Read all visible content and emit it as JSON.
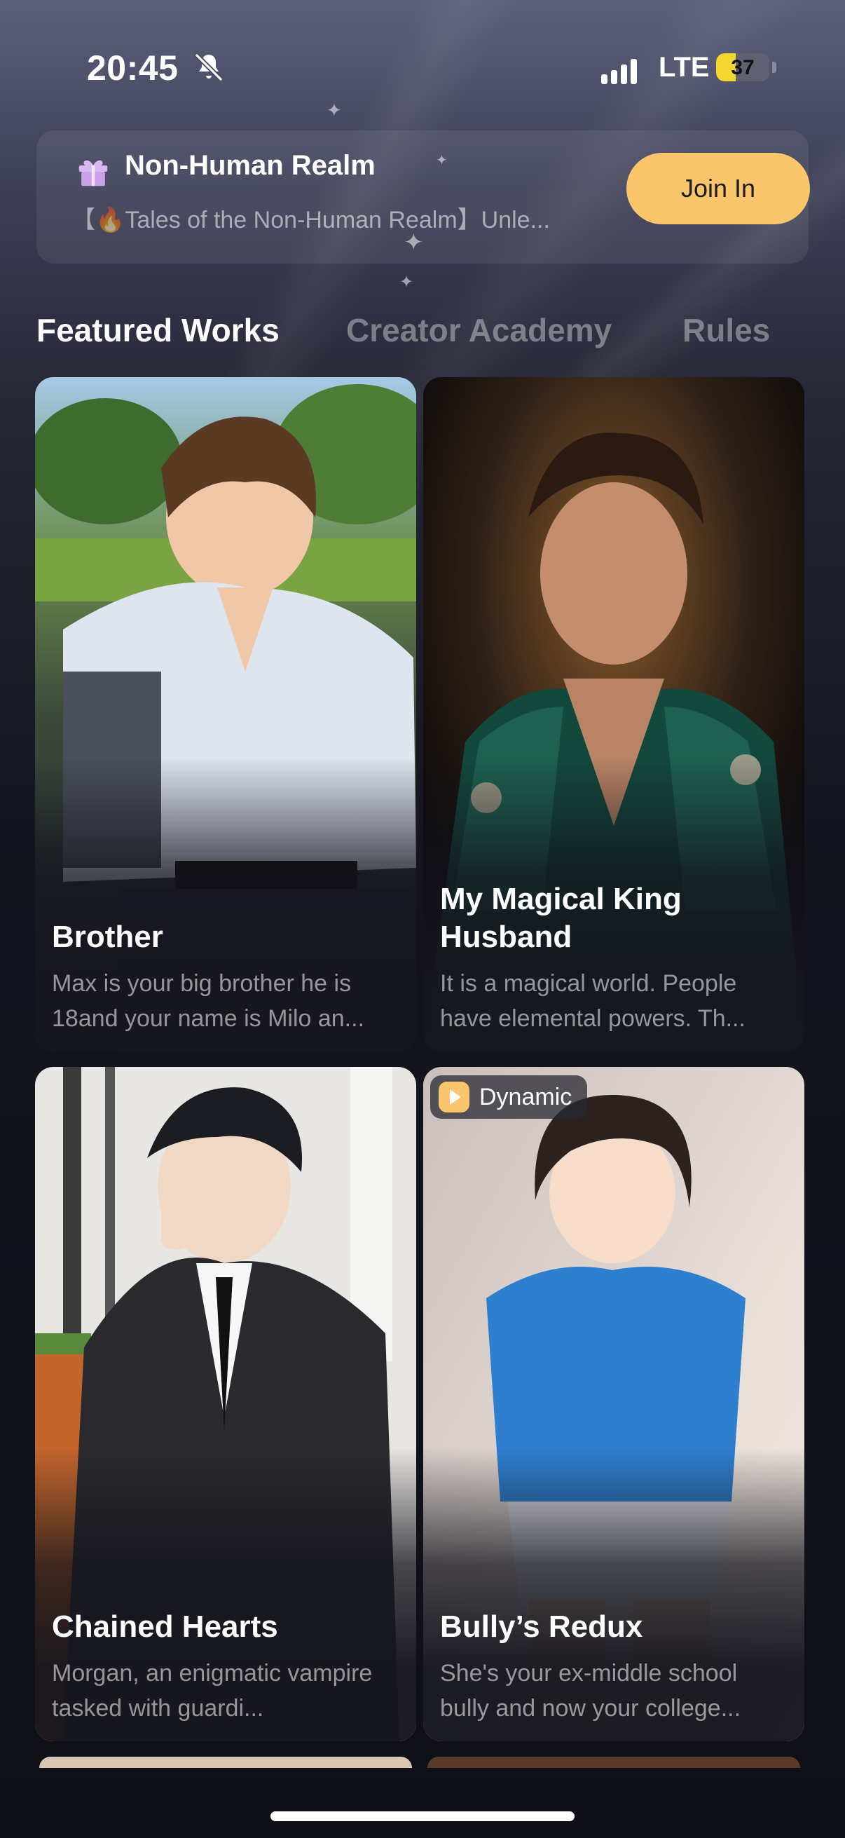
{
  "status_bar": {
    "time": "20:45",
    "network": "LTE",
    "battery_level": "37",
    "battery_fraction": 0.37,
    "icons": [
      "bell-slash-icon",
      "signal-icon"
    ]
  },
  "realm_banner": {
    "icon": "gift-icon",
    "title": "Non-Human Realm",
    "description": "【🔥Tales of the Non-Human Realm】Unle...",
    "join_label": "Join In",
    "join_color": "#fbc66b"
  },
  "tabs": [
    {
      "label": "Featured Works",
      "active": true
    },
    {
      "label": "Creator Academy",
      "active": false
    },
    {
      "label": "Rules",
      "active": false
    }
  ],
  "cards": [
    {
      "title": "Brother",
      "description": "Max is your big brother he is 18and your name is Milo an..."
    },
    {
      "title": "My Magical King Husband",
      "description": "It is a magical world. People have elemental powers. Th..."
    },
    {
      "title": "Chained Hearts",
      "description": "Morgan, an enigmatic vampire tasked with guardi..."
    },
    {
      "title": "Bully’s Redux",
      "description": "She's your ex-middle school bully and now your college...",
      "badge": "Dynamic",
      "badge_icon": "play-icon"
    }
  ],
  "colors": {
    "accent": "#fbc66b",
    "battery": "#f4d631",
    "background": "#0f0f17"
  }
}
